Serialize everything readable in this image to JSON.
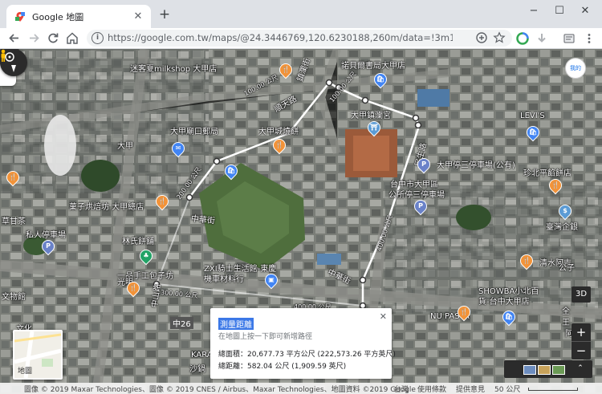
{
  "browser": {
    "tab_title": "Google 地圖",
    "new_tab_label": "+",
    "url": "https://google.com.tw/maps/@24.3446769,120.6230188,260m/data=!3m1!1e3?hl=zh-T...",
    "win_minimize": "−",
    "win_maximize": "☐",
    "win_close": "✕",
    "tab_close": "✕",
    "icons": {
      "back": "arrow-left-icon",
      "forward": "arrow-right-icon",
      "reload": "reload-icon",
      "home": "home-icon",
      "site_info": "info-icon",
      "add": "plus-circle-icon",
      "bookmark": "star-icon",
      "menu": "kebab-menu-icon"
    }
  },
  "map": {
    "sidebar_toggle": "▶",
    "avatar_text": "我的",
    "labels": [
      {
        "text": "迷客夏milkshop 大甲店"
      },
      {
        "text": "諾貝爾書局大甲店"
      },
      {
        "text": "大甲鎮瀾宮"
      },
      {
        "text": "大甲廟口郵局"
      },
      {
        "text": "大甲城燒餅"
      },
      {
        "text": "LEVI'S"
      },
      {
        "text": "大甲停三停車場(公有)"
      },
      {
        "text": "台中市大甲區\n公所停三停車場"
      },
      {
        "text": "珍北平餡餅店"
      },
      {
        "text": "菓子烘焙坊 大甲總店"
      },
      {
        "text": "草甘茶"
      },
      {
        "text": "私人停車場"
      },
      {
        "text": "林氏餅舖"
      },
      {
        "text": "臺灣企銀"
      },
      {
        "text": "一品手工包子坊"
      },
      {
        "text": "清水阿吉"
      },
      {
        "text": "ZXI騎士生活館-東慶機車材料行"
      },
      {
        "text": "SHOWBA小北百貨-台中大甲店"
      },
      {
        "text": "NU PASTA"
      },
      {
        "text": "文物館"
      },
      {
        "text": "中山路"
      },
      {
        "text": "順天路"
      },
      {
        "text": "鎮瀾街"
      },
      {
        "text": "中華街"
      },
      {
        "text": "中華街"
      },
      {
        "text": "民生路"
      },
      {
        "text": "大甲"
      },
      {
        "text": "光明"
      },
      {
        "text": "文化"
      },
      {
        "text": "中26"
      },
      {
        "text": "KARA"
      },
      {
        "text": "沙鍋"
      },
      {
        "text": "公子"
      },
      {
        "text": "全"
      },
      {
        "text": "王"
      },
      {
        "text": "阿吉"
      }
    ],
    "distance_labels": [
      "100.00 公尺",
      "100.00 公尺",
      "200.00 公尺",
      "400.00 公尺",
      "400.00 公尺",
      "300.00 公尺",
      "500.00 公尺",
      "500.00 公尺"
    ],
    "pin_icons": [
      "restaurant-pin-icon",
      "shopping-pin-icon",
      "temple-pin-icon",
      "post-office-pin-icon",
      "parking-pin-icon",
      "store-pin-icon",
      "tree-pin-icon",
      "bank-pin-icon"
    ],
    "pin_letters": {
      "restaurant": "🍴",
      "shopping": "🛍",
      "parking": "P",
      "temple": "⛩",
      "post": "✉",
      "tree": "♣",
      "bank": "$",
      "store": "▣"
    },
    "measure": {
      "title": "測量距離",
      "hint": "在地圖上按一下即可新增路徑",
      "area": "總面積：20,677.73 平方公尺 (222,573.26 平方英尺)",
      "distance": "總距離：582.04 公尺 (1,909.59 英尺)",
      "close": "✕"
    },
    "layers_label": "地圖",
    "controls": {
      "btn_3d": "3D",
      "zoom_in": "+",
      "zoom_out": "−",
      "expand": "⌃"
    },
    "footer": {
      "imagery": "圖像 © 2019 Maxar Technologies、圖像 © 2019 CNES / Airbus、Maxar Technologies、地圖資料 ©2019 Google",
      "region": "台灣",
      "terms": "使用條款",
      "feedback": "提供意見",
      "scale": "50 公尺"
    },
    "colors": {
      "accent": "#1a73e8",
      "restaurant_pin": "#f29339",
      "shopping_pin": "#4285f4",
      "parking_pin": "#6a82c9",
      "green_pin": "#21a366",
      "measure_line": "#ffffff"
    }
  }
}
